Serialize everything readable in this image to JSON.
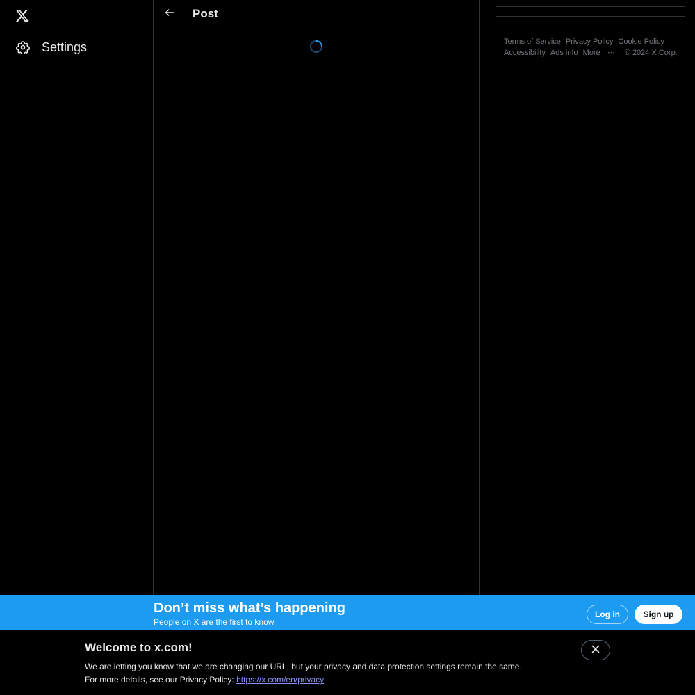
{
  "sidebar": {
    "logo_icon": "x-logo-icon",
    "settings_label": "Settings",
    "settings_icon": "gear-icon"
  },
  "header": {
    "back_icon": "back-arrow-icon",
    "title": "Post"
  },
  "footer": {
    "terms": "Terms of Service",
    "privacy": "Privacy Policy",
    "cookie": "Cookie Policy",
    "accessibility": "Accessibility",
    "ads": "Ads info",
    "more": "More",
    "more_icon": "ellipsis-icon",
    "copyright": "© 2024 X Corp."
  },
  "banner": {
    "title": "Don’t miss what’s happening",
    "subtitle": "People on X are the first to know.",
    "login": "Log in",
    "signup": "Sign up",
    "color": "#1d9bf0"
  },
  "notice": {
    "title": "Welcome to x.com!",
    "line1": "We are letting you know that we are changing our URL, but your privacy and data protection settings remain the same.",
    "line2_prefix": "For more details, see our Privacy Policy: ",
    "link": "https://x.com/en/privacy",
    "close_icon": "close-icon"
  },
  "colors": {
    "background": "#000000",
    "border": "#2f3336",
    "accent": "#1d9bf0",
    "muted_text": "#71767b"
  }
}
